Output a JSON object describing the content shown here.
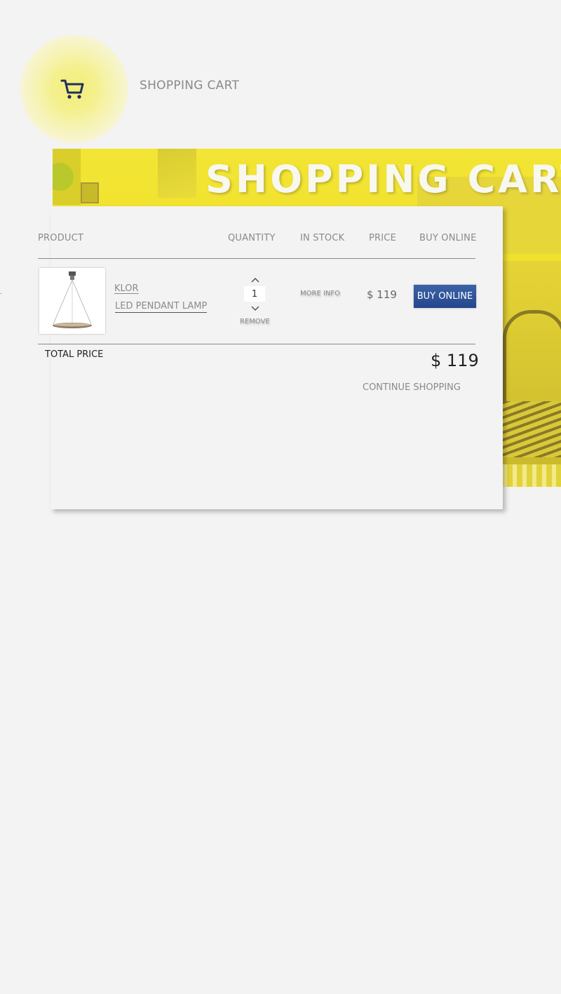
{
  "header": {
    "logo_icon": "shopping-cart-icon",
    "title": "SHOPPING CART"
  },
  "banner": {
    "text": "SHOPPING CART",
    "accent_color": "#efe02a"
  },
  "cart": {
    "columns": [
      "PRODUCT",
      "QUANTITY",
      "IN STOCK",
      "PRICE",
      "BUY ONLINE"
    ],
    "items": [
      {
        "brand": "KLOR",
        "name": "LED PENDANT LAMP",
        "quantity": "1",
        "remove_label": "REMOVE",
        "stock_label": "MORE INFO",
        "price": "$ 119",
        "buy_label": "BUY ONLINE"
      }
    ],
    "total_label": "TOTAL PRICE",
    "total_value": "$ 119",
    "continue_label": "CONTINUE SHOPPING"
  },
  "colors": {
    "button": "#2f55a0",
    "banner": "#efe02a",
    "background": "#f3f3f3"
  }
}
